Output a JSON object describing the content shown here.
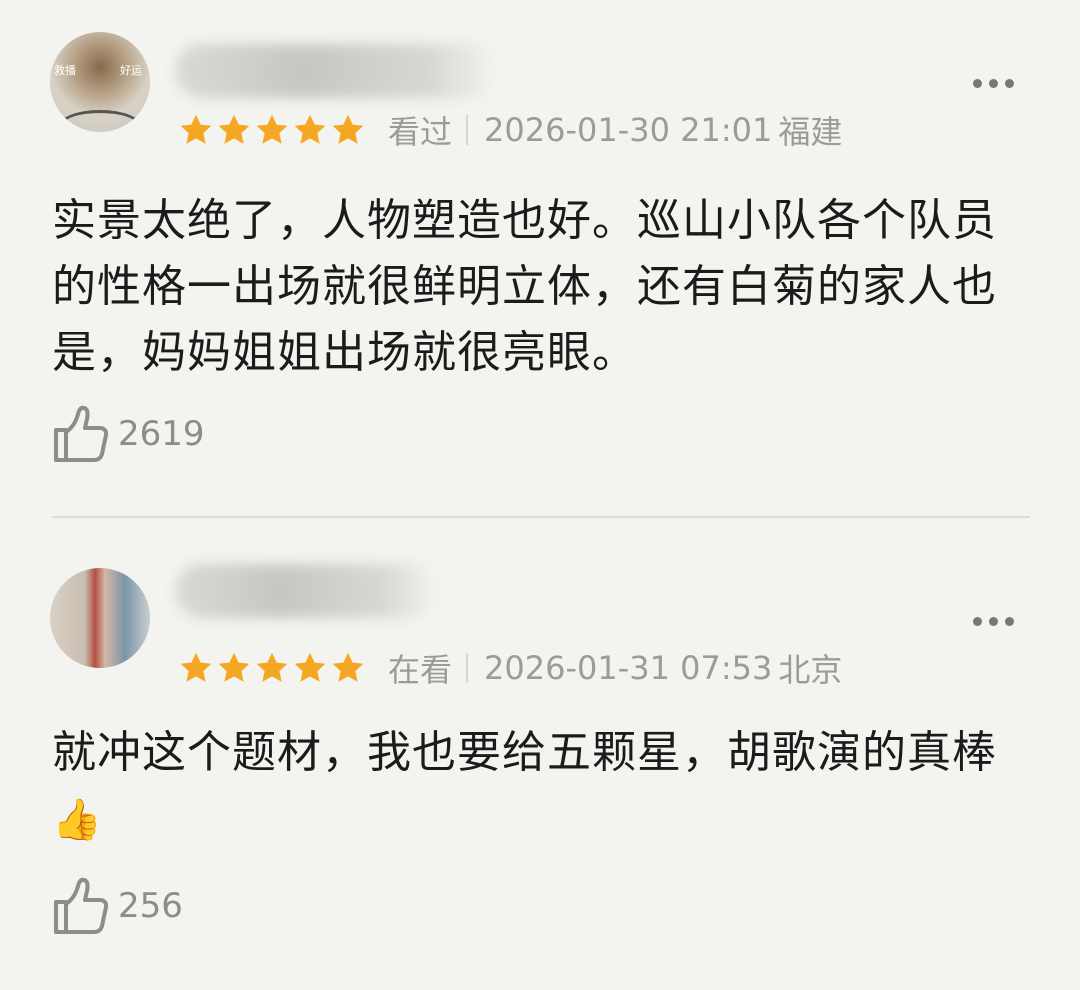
{
  "reviews": [
    {
      "avatar_tags": [
        "救播",
        "好运"
      ],
      "rating": 5,
      "status": "看过",
      "date": "2026-01-30 21:01",
      "location": "福建",
      "body": "实景太绝了，人物塑造也好。巡山小队各个队员的性格一出场就很鲜明立体，还有白菊的家人也是，妈妈姐姐出场就很亮眼。",
      "likes": "2619"
    },
    {
      "rating": 5,
      "status": "在看",
      "date": "2026-01-31 07:53",
      "location": "北京",
      "body": "就冲这个题材，我也要给五颗星，胡歌演的真棒",
      "body_emoji": "👍",
      "likes": "256"
    }
  ],
  "icons": {
    "star": "star-icon",
    "more": "more-options-icon",
    "like": "thumbs-up-icon"
  },
  "colors": {
    "background": "#f3f3ef",
    "star": "#f5a623",
    "meta_text": "#9b9b98",
    "body_text": "#1b1b1b"
  }
}
